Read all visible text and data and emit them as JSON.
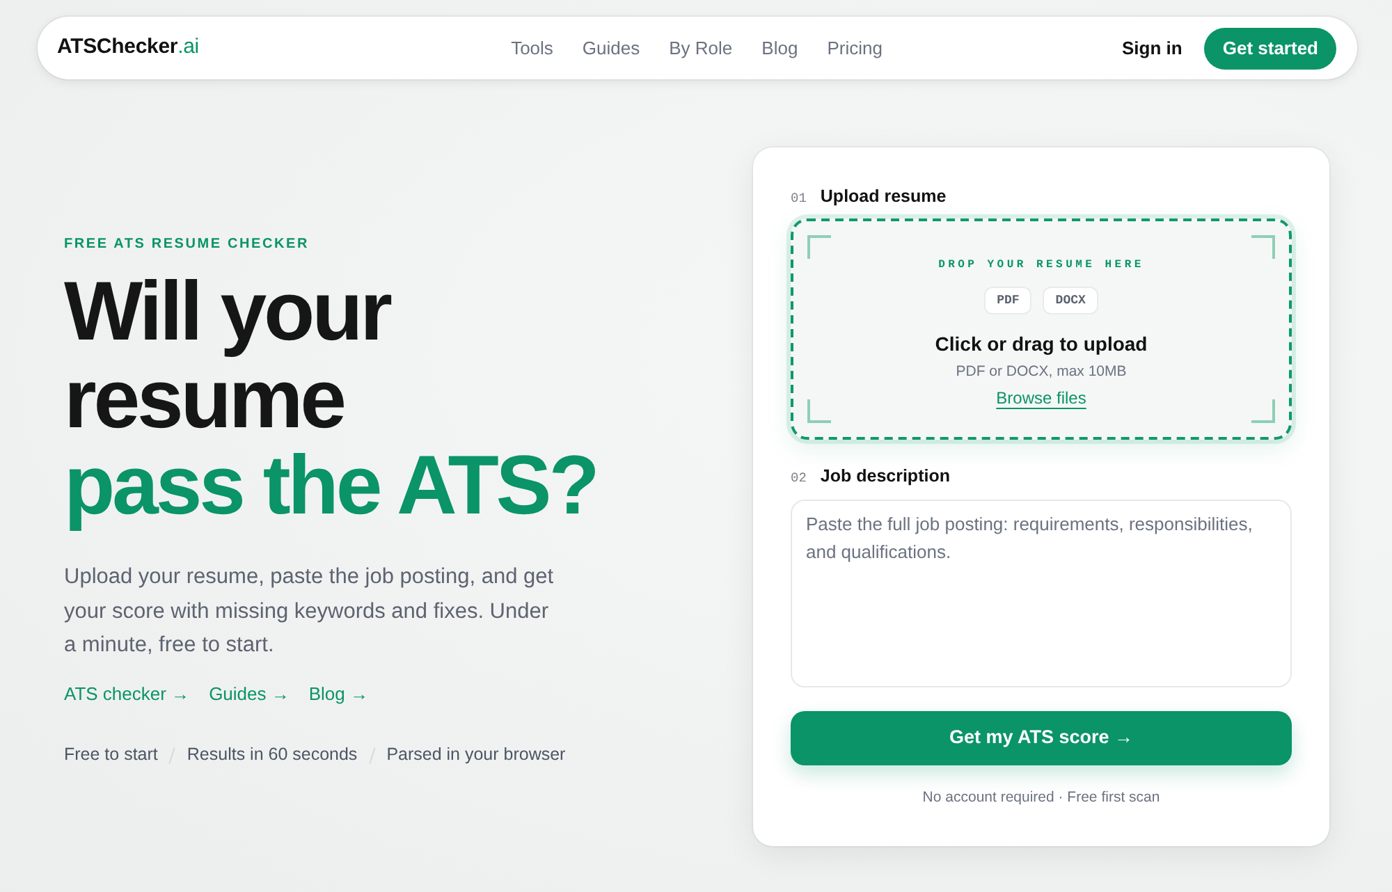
{
  "navbar": {
    "logo": {
      "name": "ATSChecker",
      "suffix": ".ai"
    },
    "links": [
      "Tools",
      "Guides",
      "By Role",
      "Blog",
      "Pricing"
    ],
    "sign_in": "Sign in",
    "cta": "Get started"
  },
  "hero": {
    "eyebrow": "FREE ATS RESUME CHECKER",
    "headline": [
      {
        "text": "Will your resume",
        "accent": false
      },
      {
        "text": "pass the ATS?",
        "accent": true
      }
    ],
    "lead": "Upload your resume, paste the job posting, and get your score with missing keywords and fixes. Under a minute, free to start.",
    "links": [
      "ATS checker →",
      "Guides →",
      "Blog →"
    ],
    "features": [
      "Free to start",
      "Results in 60 seconds",
      "Parsed in your browser"
    ]
  },
  "form": {
    "steps": [
      {
        "kind": "upload",
        "number": "01",
        "label": "Upload resume",
        "drop_label": "DROP YOUR RESUME HERE",
        "formats": [
          "PDF",
          "DOCX"
        ],
        "title": "Click or drag to upload",
        "hint": "PDF or DOCX, max 10MB",
        "browse": "Browse files"
      },
      {
        "kind": "textarea",
        "number": "02",
        "label": "Job description",
        "placeholder": "Paste the full job posting: requirements, responsibilities, and qualifications."
      }
    ],
    "submit": "Get my ATS score →",
    "note": "No account required · Free first scan"
  }
}
